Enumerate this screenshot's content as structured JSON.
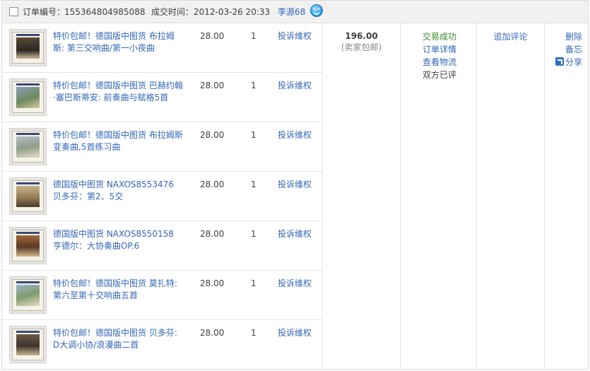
{
  "order": {
    "order_number_label": "订单编号：",
    "order_number": "155364804985088",
    "deal_time_label": "成交时间：",
    "deal_time": "2012-03-26 20:33",
    "seller": "李源68",
    "wangwang_icon": "chat-bubble-icon"
  },
  "items": [
    {
      "title": "特价包邮！德国版中图货 布拉姆斯: 第三交响曲/第一小夜曲",
      "price": "28.00",
      "qty": "1",
      "action": "投诉维权"
    },
    {
      "title": "特价包邮！德国版中图货 巴赫约翰·塞巴斯蒂安: 前奏曲与赋格5首",
      "price": "28.00",
      "qty": "1",
      "action": "投诉维权"
    },
    {
      "title": "特价包邮！德国版中图货 布拉姆斯变奏曲,5首练习曲",
      "price": "28.00",
      "qty": "1",
      "action": "投诉维权"
    },
    {
      "title": "德国版中图货 NAXOS8553476 贝多芬：第2、5交",
      "price": "28.00",
      "qty": "1",
      "action": "投诉维权"
    },
    {
      "title": "德国版中图货 NAXOS8550158 亨德尔：大协奏曲OP.6",
      "price": "28.00",
      "qty": "1",
      "action": "投诉维权"
    },
    {
      "title": "特价包邮！德国版中图货 莫扎特: 第六至第十交响曲五首",
      "price": "28.00",
      "qty": "1",
      "action": "投诉维权"
    },
    {
      "title": "特价包邮！德国版中图货 贝多芬: D大调小协/浪漫曲二首",
      "price": "28.00",
      "qty": "1",
      "action": "投诉维权"
    }
  ],
  "total": {
    "amount": "196.00",
    "note": "(卖家包邮)"
  },
  "status": {
    "state": "交易成功",
    "detail_link": "订单详情",
    "logistics_link": "查看物流",
    "review_state": "双方已评"
  },
  "review": {
    "add_review": "追加评论"
  },
  "ops": {
    "delete": "删除",
    "note": "备忘",
    "share": "分享",
    "share_icon": "share-icon"
  },
  "colors": {
    "link": "#3367b5",
    "success": "#3a8a26",
    "header_bg": "#f1f1f1",
    "border": "#dcdcdc"
  }
}
